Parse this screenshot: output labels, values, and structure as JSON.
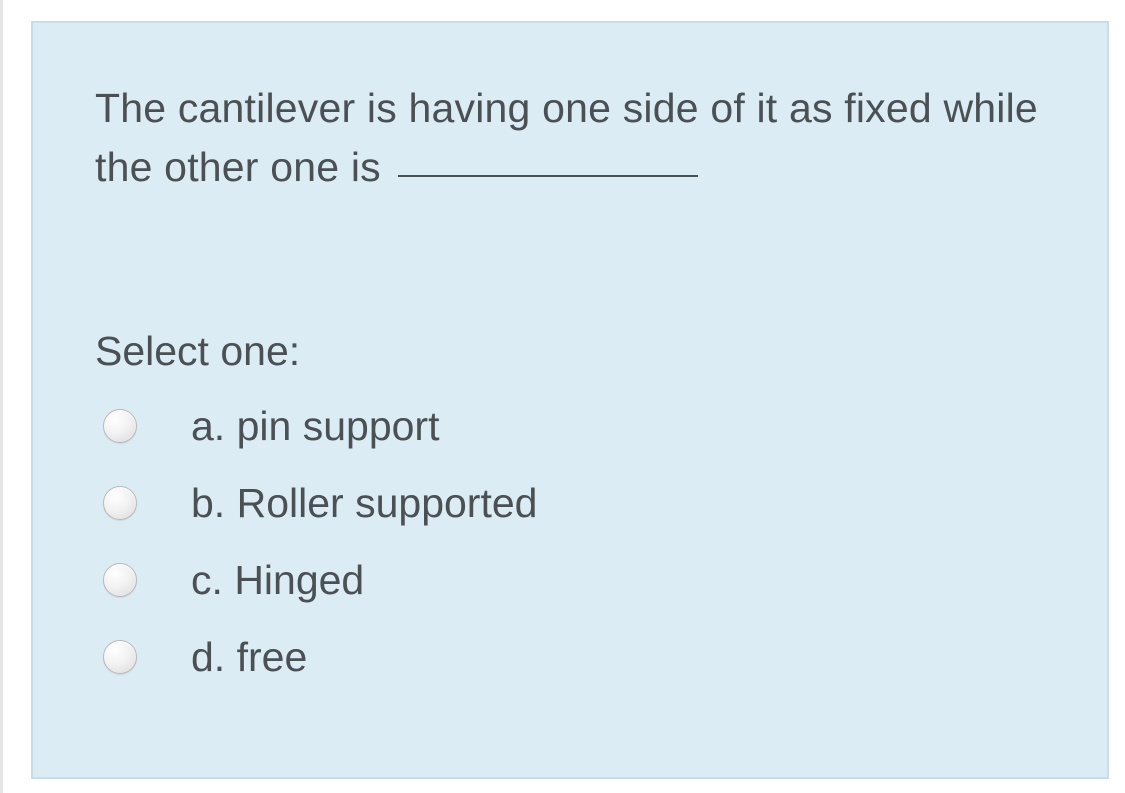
{
  "question": {
    "text_before_blank": "The cantilever is having one side of it as fixed while the other one is ",
    "select_prompt": "Select one:",
    "options": [
      {
        "letter": "a.",
        "text": "pin support"
      },
      {
        "letter": "b.",
        "text": "Roller supported"
      },
      {
        "letter": "c.",
        "text": "Hinged"
      },
      {
        "letter": "d.",
        "text": "free"
      }
    ]
  }
}
